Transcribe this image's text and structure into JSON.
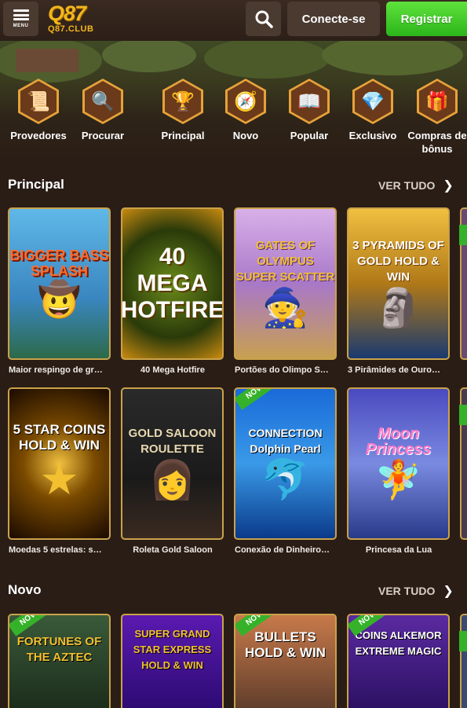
{
  "header": {
    "menu_label": "MENU",
    "logo_main": "Q87",
    "logo_sub": "Q87.CLUB",
    "search_icon": "search-icon",
    "login_label": "Conecte-se",
    "register_label": "Registrar"
  },
  "categories": [
    {
      "label": "Provedores",
      "icon": "scroll-icon"
    },
    {
      "label": "Procurar",
      "icon": "magnifier-icon"
    },
    {
      "label": "Principal",
      "icon": "laurel-icon"
    },
    {
      "label": "Novo",
      "icon": "compass-icon"
    },
    {
      "label": "Popular",
      "icon": "book-icon"
    },
    {
      "label": "Exclusivo",
      "icon": "gem-icon"
    },
    {
      "label": "Compras de bônus",
      "icon": "gift-icon"
    }
  ],
  "sections": {
    "principal": {
      "title": "Principal",
      "see_all": "VER TUDO",
      "games": [
        {
          "name": "Maior respingo de gr…",
          "art": "BIGGER BASS SPLASH"
        },
        {
          "name": "40 Mega Hotfire",
          "art": "40 MEGA HOTFIRE"
        },
        {
          "name": "Portões do Olimpo S…",
          "art": "GATES OF OLYMPUS SUPER SCATTER"
        },
        {
          "name": "3 Pirâmides de Ouro…",
          "art": "3 PYRAMIDS OF GOLD HOLD & WIN"
        },
        {
          "name": "Moedas 5 estrelas: s…",
          "art": "5 STAR COINS HOLD & WIN"
        },
        {
          "name": "Roleta Gold Saloon",
          "art": "GOLD SALOON ROULETTE"
        },
        {
          "name": "Conexão de Dinheiro…",
          "art": "CONNECTION Dolphin Pearl",
          "badge": "NOVO"
        },
        {
          "name": "Princesa da Lua",
          "art": "Moon Princess"
        }
      ]
    },
    "novo": {
      "title": "Novo",
      "see_all": "VER TUDO",
      "games": [
        {
          "art": "FORTUNES OF THE AZTEC",
          "badge": "NOVO"
        },
        {
          "art": "SUPER GRAND STAR EXPRESS HOLD & WIN"
        },
        {
          "art": "BULLETS HOLD & WIN",
          "badge": "NOVO"
        },
        {
          "art": "COINS ALKEMOR EXTREME MAGIC",
          "badge": "NOVO"
        }
      ]
    }
  }
}
